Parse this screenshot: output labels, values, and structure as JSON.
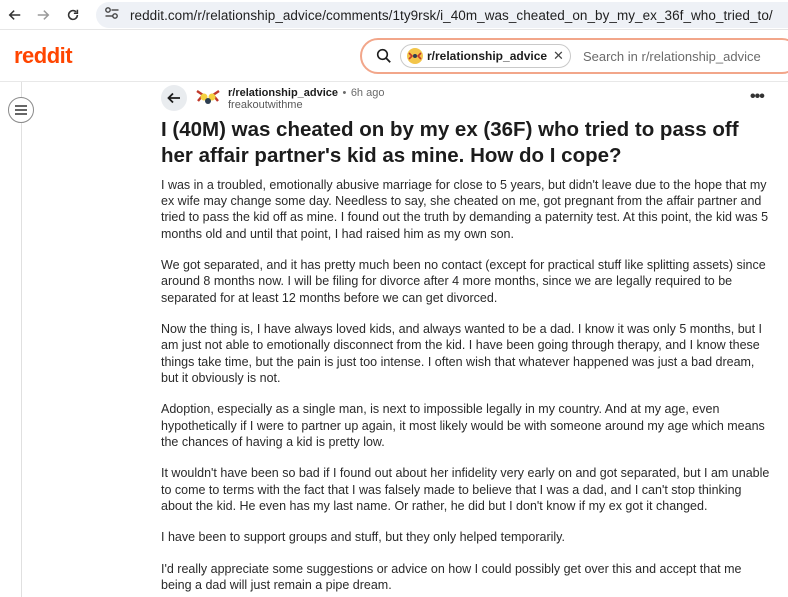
{
  "browser": {
    "url": "reddit.com/r/relationship_advice/comments/1ty9rsk/i_40m_was_cheated_on_by_my_ex_36f_who_tried_to/"
  },
  "header": {
    "logo": "reddit",
    "search_chip": "r/relationship_advice",
    "search_placeholder": "Search in r/relationship_advice"
  },
  "post": {
    "subreddit": "r/relationship_advice",
    "separator": "•",
    "time": "6h ago",
    "author": "freakoutwithme",
    "more": "•••",
    "title": "I (40M) was cheated on by my ex (36F) who tried to pass off her affair partner's kid as mine. How do I cope?",
    "paragraphs": [
      "I was in a troubled, emotionally abusive marriage for close to 5 years, but didn't leave due to the hope that my ex wife may change some day. Needless to say, she cheated on me, got pregnant from the affair partner and tried to pass the kid off as mine. I found out the truth by demanding a paternity test. At this point, the kid was 5 months old and until that point, I had raised him as my own son.",
      "We got separated, and it has pretty much been no contact (except for practical stuff like splitting assets) since around 8 months now. I will be filing for divorce after 4 more months, since we are legally required to be separated for at least 12 months before we can get divorced.",
      "Now the thing is, I have always loved kids, and always wanted to be a dad. I know it was only 5 months, but I am just not able to emotionally disconnect from the kid. I have been going through therapy, and I know these things take time, but the pain is just too intense. I often wish that whatever happened was just a bad dream, but it obviously is not.",
      "Adoption, especially as a single man, is next to impossible legally in my country. And at my age, even hypothetically if I were to partner up again, it most likely would be with someone around my age which means the chances of having a kid is pretty low.",
      "It wouldn't have been so bad if I found out about her infidelity very early on and got separated, but I am unable to come to terms with the fact that I was falsely made to believe that I was a dad, and I can't stop thinking about the kid. He even has my last name. Or rather, he did but I don't know if my ex got it changed.",
      "I have been to support groups and stuff, but they only helped temporarily.",
      "I'd really appreciate some suggestions or advice on how I could possibly get over this and accept that me being a dad will just remain a pipe dream."
    ]
  },
  "colors": {
    "brand": "#ff4500",
    "search_border": "#f2a68a",
    "urlbar_bg": "#eef1f6"
  }
}
